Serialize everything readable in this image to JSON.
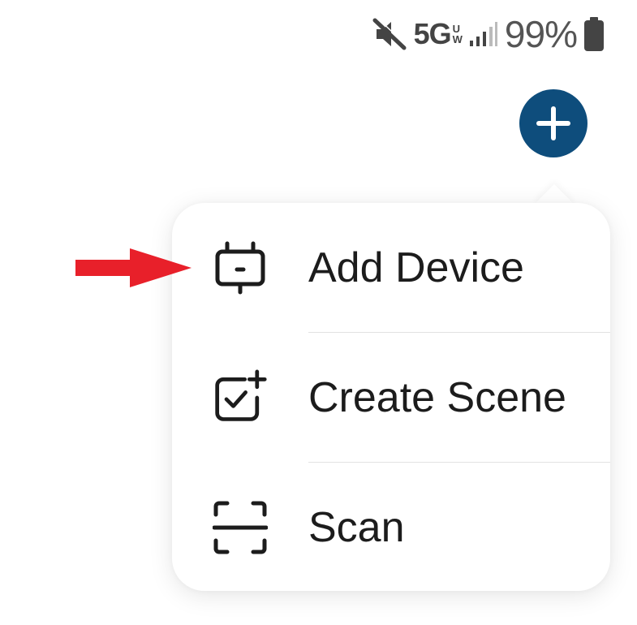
{
  "status_bar": {
    "network": "5G",
    "network_sub_top": "U",
    "network_sub_bottom": "W",
    "battery_percent": "99%",
    "icons": [
      "mute-icon",
      "signal-icon",
      "battery-icon"
    ]
  },
  "fab": {
    "icon": "plus-icon",
    "color": "#0e4d7c"
  },
  "menu": {
    "items": [
      {
        "label": "Add Device",
        "icon": "device-icon"
      },
      {
        "label": "Create Scene",
        "icon": "create-scene-icon"
      },
      {
        "label": "Scan",
        "icon": "scan-icon"
      }
    ]
  },
  "annotation": {
    "arrow_color": "#e8202a"
  }
}
